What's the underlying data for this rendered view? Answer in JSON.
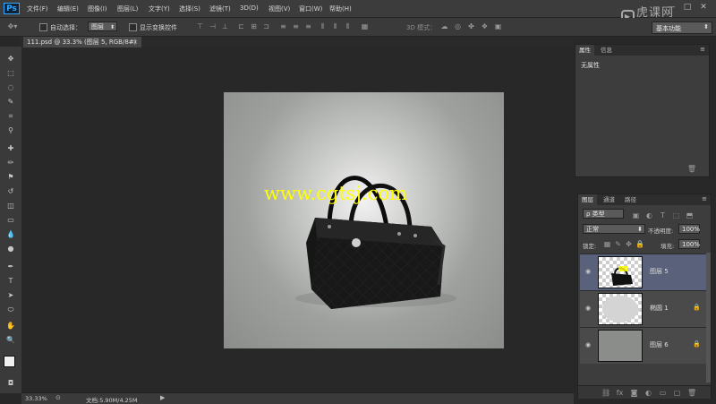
{
  "app": {
    "logo": "Ps",
    "brand_watermark": "虎课网"
  },
  "menu": [
    "文件(F)",
    "编辑(E)",
    "图像(I)",
    "图层(L)",
    "文字(Y)",
    "选择(S)",
    "滤镜(T)",
    "3D(D)",
    "视图(V)",
    "窗口(W)",
    "帮助(H)"
  ],
  "window_controls": {
    "minimize": "—",
    "maximize": "□",
    "close": "✕"
  },
  "options": {
    "auto_select_label": "自动选择：",
    "auto_select_value": "图层",
    "show_transform_label": "显示变换控件",
    "mode_3d_label": "3D 模式：",
    "workspace": "基本功能"
  },
  "document": {
    "tab_title": "111.psd @ 33.3% (图层 5, RGB/8#) *",
    "watermark_text": "www.cgtsj.com"
  },
  "status": {
    "zoom": "33.33%",
    "doc_size": "文档:5.90M/4.25M"
  },
  "properties_panel": {
    "tabs": [
      "属性",
      "信息"
    ],
    "content": "无属性"
  },
  "layers_panel": {
    "tabs": [
      "图层",
      "通道",
      "路径"
    ],
    "filter_type": "ρ 类型",
    "blend_mode": "正常",
    "opacity_label": "不透明度:",
    "opacity_value": "100%",
    "lock_label": "锁定:",
    "fill_label": "填充:",
    "fill_value": "100%",
    "layers": [
      {
        "name": "图层 5",
        "selected": true
      },
      {
        "name": "椭圆 1",
        "selected": false
      },
      {
        "name": "图层 6",
        "selected": false
      }
    ]
  },
  "colors": {
    "accent_selected_layer": "#59627a",
    "watermark": "#ffff00"
  }
}
